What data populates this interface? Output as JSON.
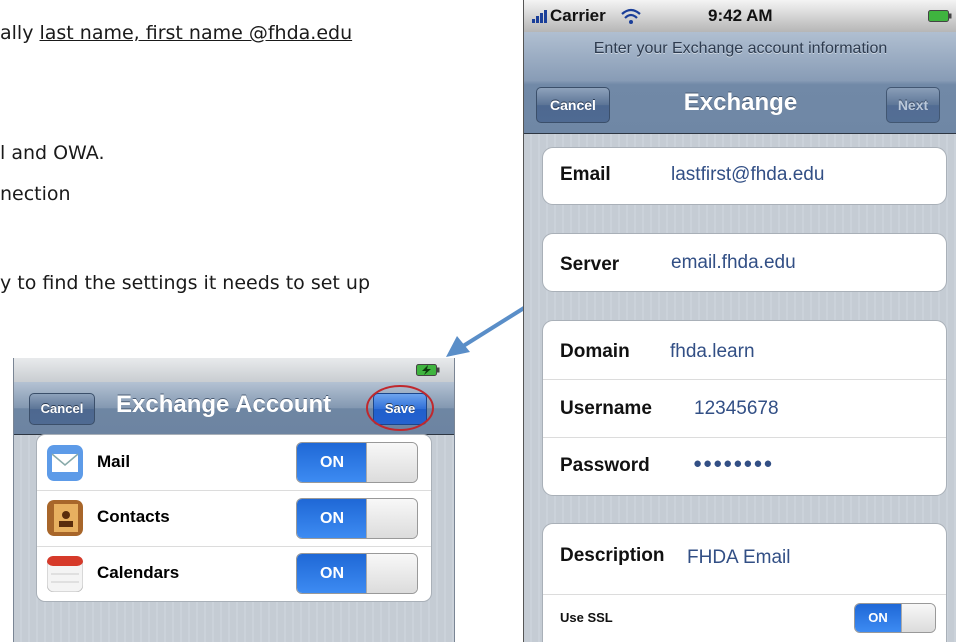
{
  "doc": {
    "line1": "ally ",
    "line1_link": "last name, first name @fhda.edu",
    "line2": "l and OWA.",
    "line3": "nection",
    "line4": "y to find the settings it needs to set up"
  },
  "left_screen": {
    "cancel": "Cancel",
    "title": "Exchange Account",
    "save": "Save",
    "rows": [
      {
        "label": "Mail",
        "state": "ON",
        "icon": "mail-icon"
      },
      {
        "label": "Contacts",
        "state": "ON",
        "icon": "contacts-icon"
      },
      {
        "label": "Calendars",
        "state": "ON",
        "icon": "calendar-icon"
      }
    ]
  },
  "right_screen": {
    "carrier": "Carrier",
    "time": "9:42 AM",
    "prompt": "Enter your Exchange account information",
    "cancel": "Cancel",
    "title": "Exchange",
    "next": "Next",
    "email_label": "Email",
    "email_value": "lastfirst@fhda.edu",
    "server_label": "Server",
    "server_value": "email.fhda.edu",
    "domain_label": "Domain",
    "domain_value": "fhda.learn",
    "username_label": "Username",
    "username_value": "12345678",
    "password_label": "Password",
    "password_value": "●●●●●●●●",
    "description_label": "Description",
    "description_value": "FHDA Email",
    "ssl_label": "Use SSL",
    "ssl_state": "ON"
  },
  "colors": {
    "toggle_on": "#2f7ae6",
    "value_text": "#324f85",
    "arrow": "#5a8ec8",
    "highlight_circle": "#c0282d"
  }
}
